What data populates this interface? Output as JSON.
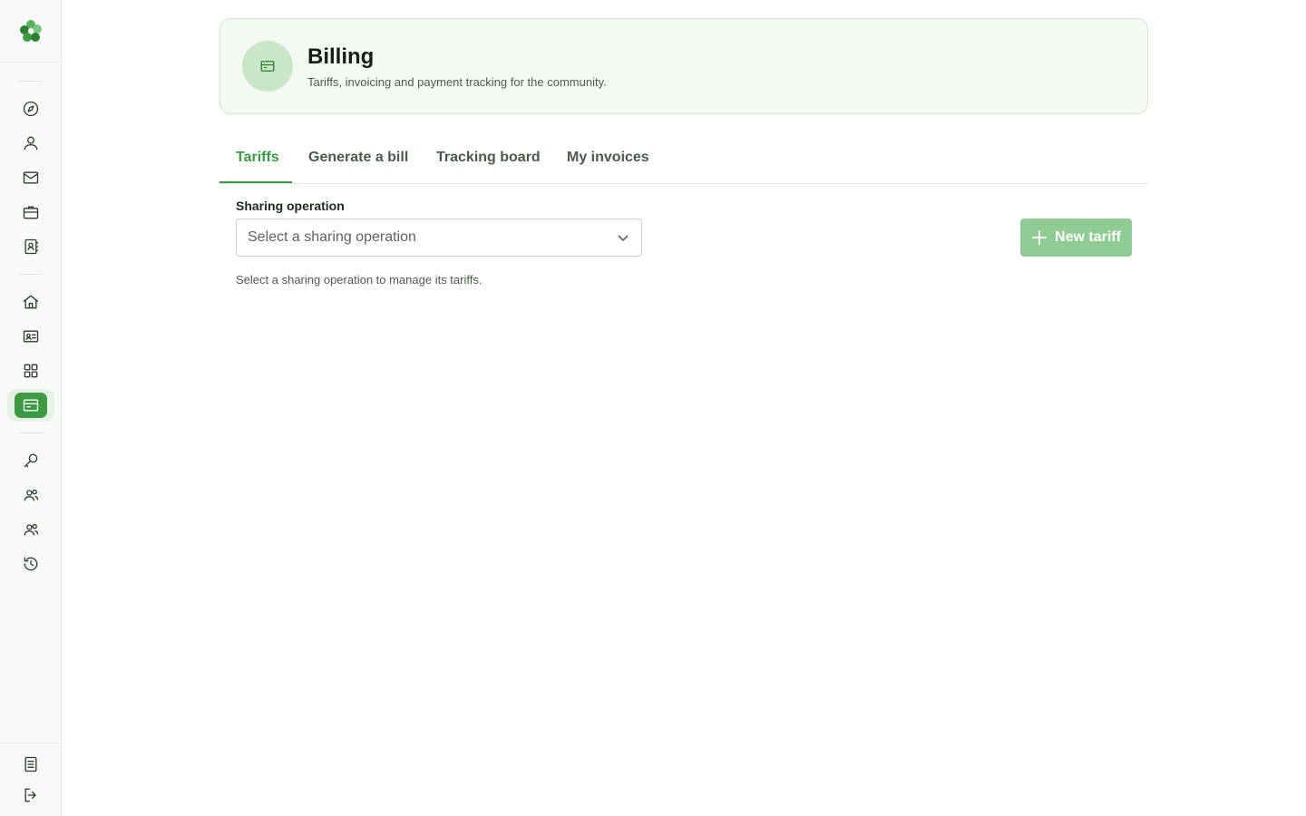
{
  "colors": {
    "accent": "#3c9a44",
    "header_bg": "#f4faf3",
    "button_disabled": "#8fcb93"
  },
  "sidebar": {
    "logo": "clover-logo-icon",
    "items": [
      {
        "icon": "compass-icon"
      },
      {
        "icon": "user-icon"
      },
      {
        "icon": "mail-icon"
      },
      {
        "icon": "briefcase-icon"
      },
      {
        "icon": "contacts-book-icon"
      },
      {
        "icon": "home-icon"
      },
      {
        "icon": "id-card-icon"
      },
      {
        "icon": "grid-icon"
      },
      {
        "icon": "billing-card-icon",
        "active": true
      },
      {
        "icon": "key-icon"
      },
      {
        "icon": "users-group-icon"
      },
      {
        "icon": "users-group-alt-icon"
      },
      {
        "icon": "history-icon"
      }
    ],
    "footer": [
      {
        "icon": "document-list-icon"
      },
      {
        "icon": "logout-icon"
      }
    ]
  },
  "header": {
    "title": "Billing",
    "subtitle": "Tariffs, invoicing and payment tracking for the community."
  },
  "tabs": [
    {
      "label": "Tariffs",
      "active": true
    },
    {
      "label": "Generate a bill"
    },
    {
      "label": "Tracking board"
    },
    {
      "label": "My invoices"
    }
  ],
  "form": {
    "sharing_label": "Sharing operation",
    "sharing_placeholder": "Select a sharing operation",
    "helper": "Select a sharing operation to manage its tariffs."
  },
  "actions": {
    "new_tariff": "New tariff",
    "new_tariff_disabled": true
  }
}
